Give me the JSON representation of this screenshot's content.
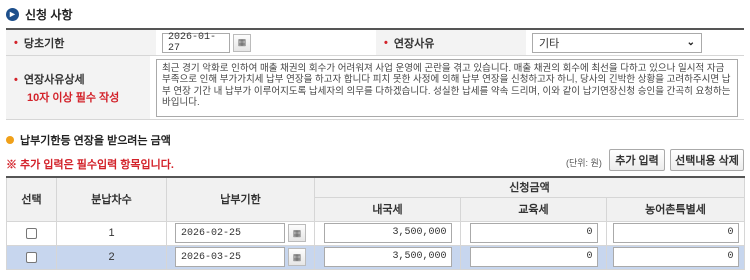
{
  "section_title": "신청 사항",
  "form": {
    "due_date_label": "당초기한",
    "due_date_value": "2026-01-27",
    "reason_label": "연장사유",
    "reason_value": "기타",
    "detail_label": "연장사유상세",
    "detail_note": "10자 이상 필수 작성",
    "detail_text": "최근 경기 악화로 인하여 매출 채권의 회수가 어려워져 사업 운영에 곤란을 겪고 있습니다. 매출 채권의 회수에 최선을 다하고 있으나 일시적 자금 부족으로 인해 부가가치세 납부 연장을 하고자 합니다 피치 못한 사정에 의해 납부 연장을 신청하고자 하니, 당사의 긴박한 상황을 고려하주시면 납부 연장 기간 내 납부가 이루어지도록 납세자의 의무를 다하겠습니다. 성실한 납세를 약속 드리며, 이와 같이 납기연장신청 승인을 간곡히 요청하는 바입니다."
  },
  "amount_section_title": "납부기한등 연장을 받으려는 금액",
  "notice": "※ 추가 입력은 필수입력 항목입니다.",
  "unit": "(단위: 원)",
  "buttons": {
    "add": "추가 입력",
    "delete": "선택내용 삭제"
  },
  "table": {
    "headers": {
      "select": "선택",
      "installment": "분납차수",
      "due_date": "납부기한",
      "amount_group": "신청금액",
      "national_tax": "내국세",
      "education_tax": "교육세",
      "rural_tax": "농어촌특별세"
    },
    "rows": [
      {
        "no": "1",
        "date": "2026-02-25",
        "national": "3,500,000",
        "education": "0",
        "rural": "0",
        "selected": false
      },
      {
        "no": "2",
        "date": "2026-03-25",
        "national": "3,500,000",
        "education": "0",
        "rural": "0",
        "selected": true
      }
    ]
  },
  "colors": {
    "accent": "#1d4f8c",
    "required": "#d3222a",
    "selected_row": "#c7d6ee"
  }
}
